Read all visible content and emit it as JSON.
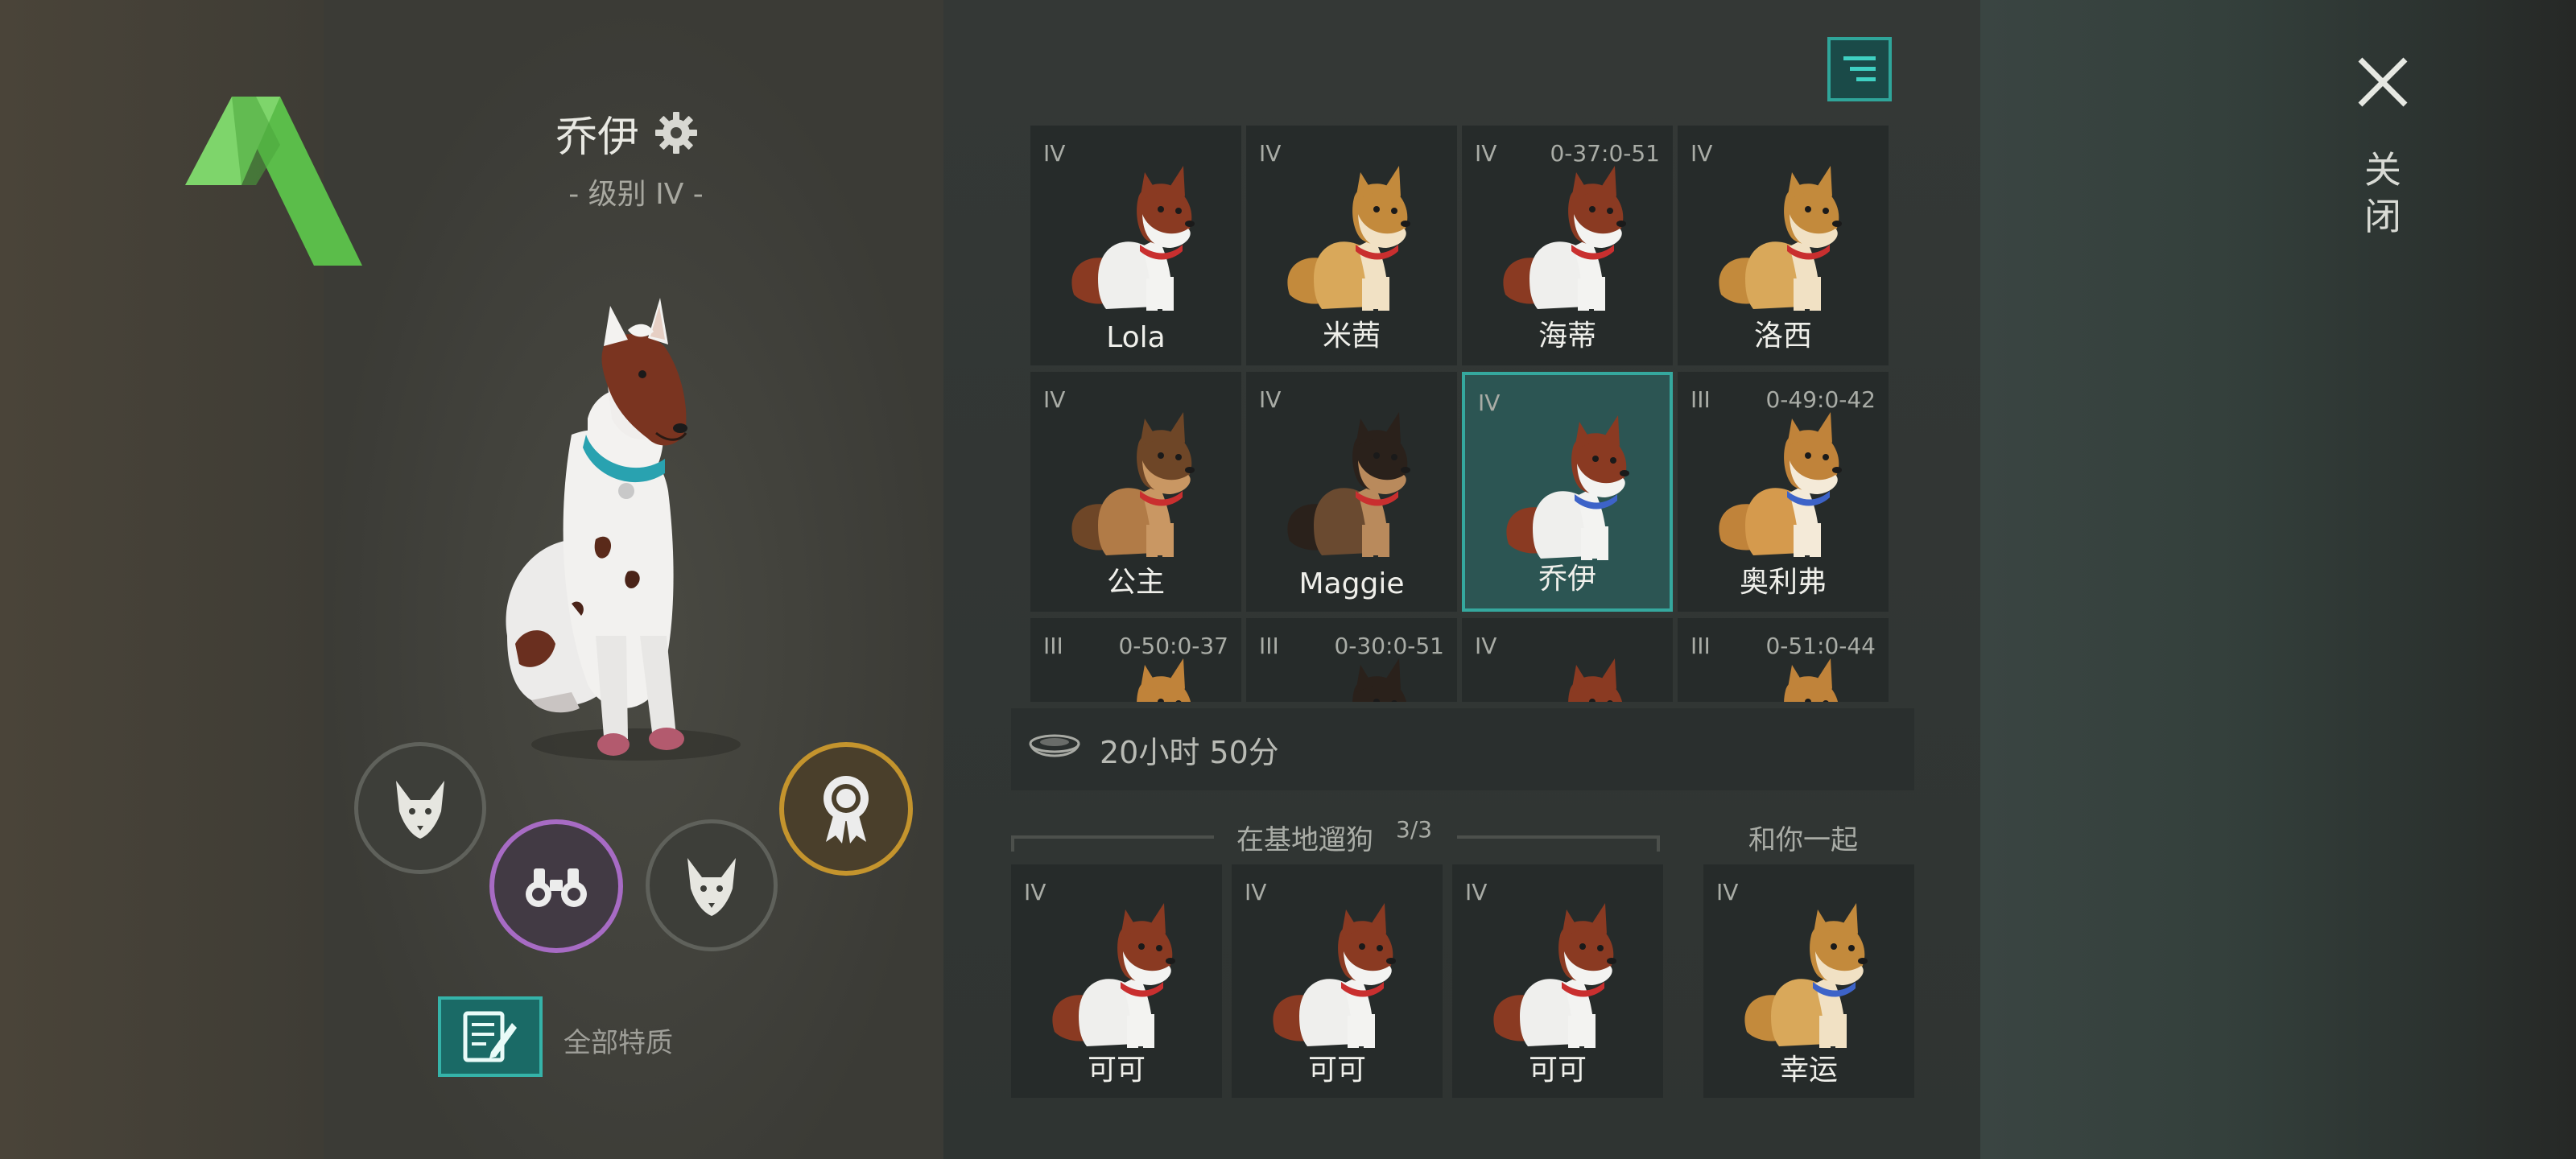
{
  "dog": {
    "name": "乔伊",
    "level": "- 级别 IV -"
  },
  "icons": {
    "logo": "green-a-logo",
    "settings": "gear-icon",
    "close": "close-icon",
    "filter": "filter-icon",
    "food": "food-bowl-icon",
    "traits": "notes-icon"
  },
  "actions": {
    "fox_left": "fox-icon",
    "binoculars": "binoculars-icon",
    "fox_right": "fox-icon",
    "award": "award-icon",
    "all_traits_label": "全部特质"
  },
  "close_label": "关闭",
  "colors": {
    "accent": "#35a89e",
    "purple": "#a76bc4",
    "gold": "#c4942d",
    "logo_green": "#5fbf4e"
  },
  "dog_grid": [
    {
      "level": "IV",
      "timer": "",
      "name": "Lola",
      "breed": "husky",
      "collar": "#c92f2f"
    },
    {
      "level": "IV",
      "timer": "",
      "name": "米茜",
      "breed": "shiba",
      "collar": "#c92f2f"
    },
    {
      "level": "IV",
      "timer": "0-37:0-51",
      "name": "海蒂",
      "breed": "husky",
      "collar": "#c92f2f"
    },
    {
      "level": "IV",
      "timer": "",
      "name": "洛西",
      "breed": "shiba",
      "collar": "#c92f2f"
    },
    {
      "level": "IV",
      "timer": "",
      "name": "公主",
      "breed": "shepherd",
      "collar": "#c92f2f"
    },
    {
      "level": "IV",
      "timer": "",
      "name": "Maggie",
      "breed": "shepherd-dark",
      "collar": "#c92f2f"
    },
    {
      "level": "IV",
      "timer": "",
      "name": "乔伊",
      "breed": "husky",
      "collar": "#3d63c8",
      "selected": true
    },
    {
      "level": "III",
      "timer": "0-49:0-42",
      "name": "奥利弗",
      "breed": "corgi",
      "collar": "#3d63c8"
    },
    {
      "level": "III",
      "timer": "0-50:0-37",
      "name": "",
      "breed": "corgi",
      "collar": "#c92f2f"
    },
    {
      "level": "III",
      "timer": "0-30:0-51",
      "name": "",
      "breed": "shepherd-dark",
      "collar": "#c92f2f"
    },
    {
      "level": "IV",
      "timer": "",
      "name": "",
      "breed": "husky",
      "collar": "#c92f2f"
    },
    {
      "level": "III",
      "timer": "0-51:0-44",
      "name": "",
      "breed": "corgi",
      "collar": "#c92f2f"
    }
  ],
  "food": {
    "time": "20小时 50分"
  },
  "walk_section": {
    "title": "在基地遛狗",
    "count": "3/3"
  },
  "walk_dogs": [
    {
      "level": "IV",
      "name": "可可",
      "breed": "husky",
      "collar": "#c92f2f"
    },
    {
      "level": "IV",
      "name": "可可",
      "breed": "husky",
      "collar": "#c92f2f"
    },
    {
      "level": "IV",
      "name": "可可",
      "breed": "husky",
      "collar": "#c92f2f"
    }
  ],
  "with_you_section": {
    "title": "和你一起"
  },
  "with_you_dogs": [
    {
      "level": "IV",
      "name": "幸运",
      "breed": "shiba",
      "collar": "#3d63c8"
    }
  ]
}
